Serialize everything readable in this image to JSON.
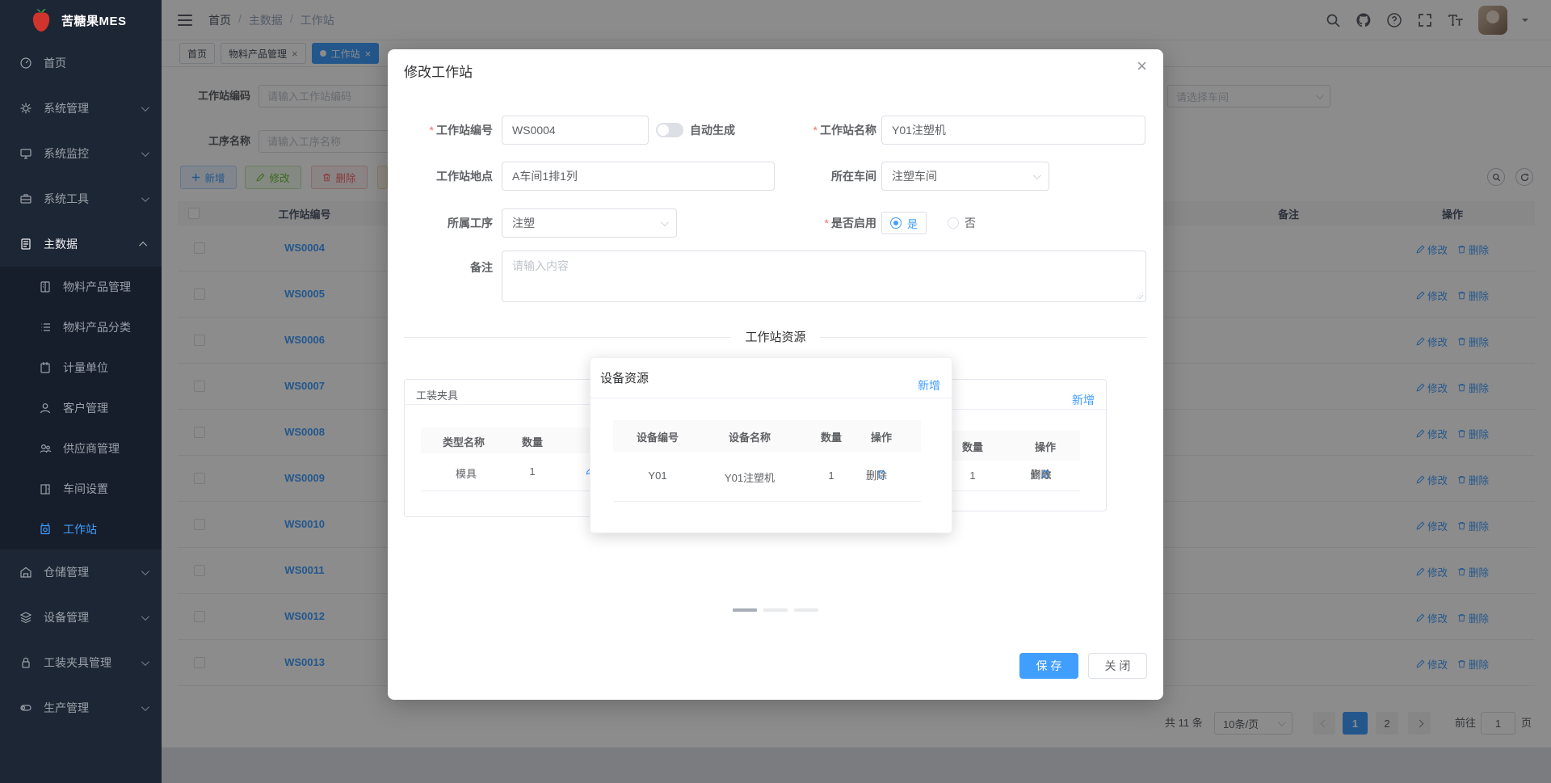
{
  "app": {
    "title": "苦糖果MES"
  },
  "colors": {
    "accent": "#409eff",
    "success": "#67c23a",
    "danger": "#f56c6c",
    "warning": "#e6a23c",
    "sidebar_bg": "#1d2634"
  },
  "sidebar": {
    "items": [
      {
        "label": "首页",
        "icon": "dashboard-icon",
        "kind": "item"
      },
      {
        "label": "系统管理",
        "icon": "gear-icon",
        "kind": "group"
      },
      {
        "label": "系统监控",
        "icon": "monitor-icon",
        "kind": "group"
      },
      {
        "label": "系统工具",
        "icon": "toolbox-icon",
        "kind": "group"
      },
      {
        "label": "主数据",
        "icon": "document-icon",
        "kind": "group",
        "open": true,
        "children": [
          {
            "label": "物料产品管理",
            "icon": "material-icon"
          },
          {
            "label": "物料产品分类",
            "icon": "category-icon"
          },
          {
            "label": "计量单位",
            "icon": "unit-icon"
          },
          {
            "label": "客户管理",
            "icon": "customer-icon"
          },
          {
            "label": "供应商管理",
            "icon": "supplier-icon"
          },
          {
            "label": "车间设置",
            "icon": "workshop-icon"
          },
          {
            "label": "工作站",
            "icon": "workstation-icon",
            "active": true
          }
        ]
      },
      {
        "label": "仓储管理",
        "icon": "warehouse-icon",
        "kind": "group"
      },
      {
        "label": "设备管理",
        "icon": "device-icon",
        "kind": "group"
      },
      {
        "label": "工装夹具管理",
        "icon": "fixture-icon",
        "kind": "group"
      },
      {
        "label": "生产管理",
        "icon": "production-icon",
        "kind": "group"
      }
    ]
  },
  "navbar": {
    "breadcrumb": [
      "首页",
      "主数据",
      "工作站"
    ]
  },
  "tags": {
    "items": [
      {
        "label": "首页",
        "closable": false,
        "active": false
      },
      {
        "label": "物料产品管理",
        "closable": true,
        "active": false
      },
      {
        "label": "工作站",
        "closable": true,
        "active": true
      }
    ]
  },
  "search": {
    "code_label": "工作站编码",
    "code_placeholder": "请输入工作站编码",
    "process_label": "工序名称",
    "process_placeholder": "请输入工序名称",
    "workshop_placeholder": "请选择车间"
  },
  "toolbar": {
    "add": "新增",
    "edit": "修改",
    "delete": "删除"
  },
  "table": {
    "headers": {
      "code": "工作站编号",
      "remark": "备注",
      "action": "操作"
    },
    "row_edit": "修改",
    "row_delete": "删除",
    "rows": [
      {
        "code": "WS0004"
      },
      {
        "code": "WS0005"
      },
      {
        "code": "WS0006"
      },
      {
        "code": "WS0007"
      },
      {
        "code": "WS0008"
      },
      {
        "code": "WS0009"
      },
      {
        "code": "WS0010"
      },
      {
        "code": "WS0011"
      },
      {
        "code": "WS0012"
      },
      {
        "code": "WS0013"
      }
    ]
  },
  "pagination": {
    "total": "共 11 条",
    "page_size": "10条/页",
    "pages": [
      "1",
      "2"
    ],
    "active_page": "1",
    "goto_label": "前往",
    "goto_value": "1",
    "goto_unit": "页"
  },
  "dialog": {
    "title": "修改工作站",
    "fields": {
      "code_label": "工作站编号",
      "code_value": "WS0004",
      "auto_generate": "自动生成",
      "name_label": "工作站名称",
      "name_value": "Y01注塑机",
      "location_label": "工作站地点",
      "location_value": "A车间1排1列",
      "workshop_label": "所在车间",
      "workshop_value": "注塑车间",
      "process_label": "所属工序",
      "process_value": "注塑",
      "enabled_label": "是否启用",
      "enabled_yes": "是",
      "enabled_no": "否",
      "remark_label": "备注",
      "remark_placeholder": "请输入内容"
    },
    "resources": {
      "divider": "工作站资源",
      "fixture_card": {
        "title": "工装夹具",
        "headers": {
          "type": "类型名称",
          "qty": "数量"
        },
        "row": {
          "type": "模具",
          "qty": "1"
        }
      },
      "device_card": {
        "title": "设备资源",
        "add": "新增",
        "headers": {
          "code": "设备编号",
          "name": "设备名称",
          "qty": "数量",
          "action": "操作"
        },
        "row": {
          "code": "Y01",
          "name": "Y01注塑机",
          "qty": "1",
          "delete": "删除"
        }
      },
      "right_card": {
        "add": "新增",
        "headers": {
          "qty": "数量",
          "action": "操作"
        },
        "row": {
          "qty": "1",
          "edit": "修改",
          "delete": "删除"
        }
      }
    },
    "footer": {
      "save": "保 存",
      "close": "关 闭"
    }
  }
}
